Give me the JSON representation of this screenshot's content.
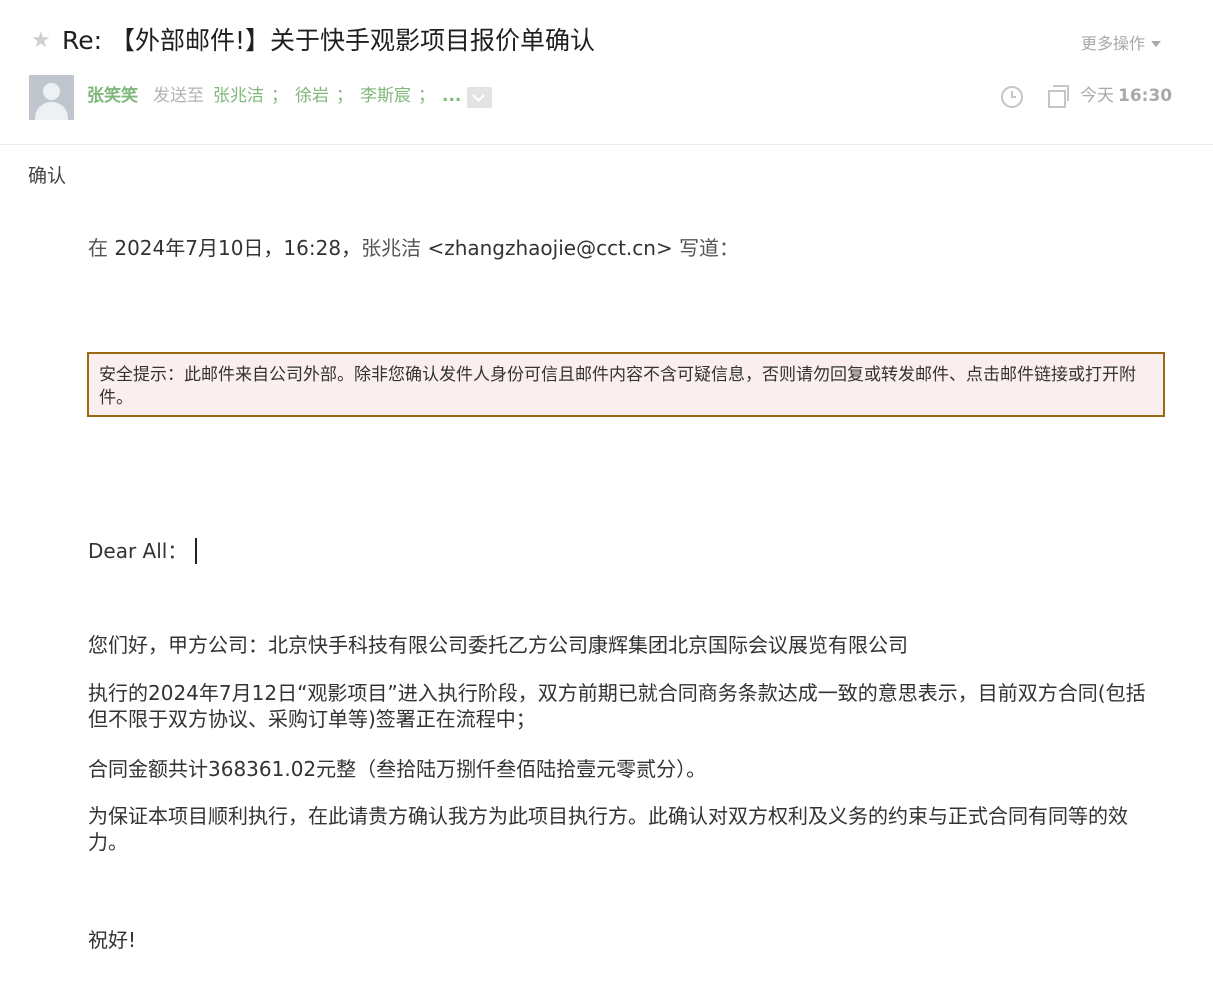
{
  "header": {
    "subject": "Re: 【外部邮件!】关于快手观影项目报价单确认",
    "more_actions": "更多操作",
    "sender_name": "张笑笑",
    "send_to_label": "发送至",
    "recipients": [
      "张兆洁",
      "徐岩",
      "李斯宸"
    ],
    "recipients_more": "...",
    "recipient_separator": "；",
    "date_label": "今天",
    "time": "16:30"
  },
  "body": {
    "confirm": "确认",
    "quote_prefix": "在",
    "quote_date": "2024年7月10日，16:28，",
    "quote_sender": "张兆洁",
    "quote_email": "<zhangzhaojie@cct.cn>",
    "quote_suffix": "写道：",
    "warning": "安全提示：此邮件来自公司外部。除非您确认发件人身份可信且邮件内容不含可疑信息，否则请勿回复或转发邮件、点击邮件链接或打开附件。",
    "greeting": "Dear All：",
    "paragraph1": "您们好，甲方公司：北京快手科技有限公司委托乙方公司康辉集团北京国际会议展览有限公司",
    "paragraph2": "执行的2024年7月12日“观影项目”进入执行阶段，双方前期已就合同商务条款达成一致的意思表示，目前双方合同(包括但不限于双方协议、采购订单等)签署正在流程中；",
    "paragraph3": "合同金额共计368361.02元整（叁拾陆万捌仟叁佰陆拾壹元零贰分）。",
    "paragraph4": "为保证本项目顺利执行，在此请贵方确认我方为此项目执行方。此确认对双方权利及义务的约束与正式合同有同等的效力。",
    "closing": "祝好!"
  },
  "icons": {
    "star": "star-icon",
    "avatar": "avatar",
    "expand": "chevron-down-icon",
    "clock": "clock-icon",
    "copy": "copy-icon",
    "caret": "caret-down-icon"
  },
  "colors": {
    "link_green": "#7fb87a",
    "muted": "#a9a9a9",
    "warning_border": "#9a6a12",
    "warning_bg": "#fbeeee"
  }
}
